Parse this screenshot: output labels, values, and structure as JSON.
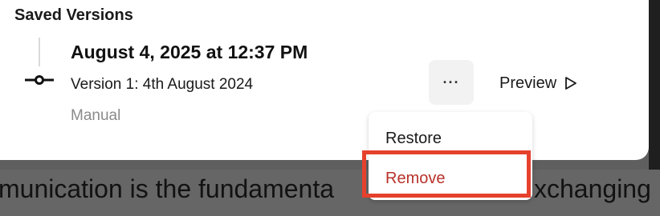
{
  "background_text": {
    "left": "munication is the fundamenta",
    "right": "xchanging"
  },
  "panel": {
    "title": "Saved Versions",
    "version": {
      "date": "August 4, 2025 at 12:37 PM",
      "name": "Version 1: 4th August 2024",
      "type": "Manual"
    },
    "more_label": "···",
    "preview_label": "Preview"
  },
  "menu": {
    "items": [
      {
        "label": "Restore"
      },
      {
        "label": "Remove"
      }
    ],
    "highlighted": "Remove"
  },
  "colors": {
    "remove_text": "#b8322a",
    "highlight_border": "#e5412d"
  },
  "icons": {
    "commit": "commit-icon",
    "preview": "play-outline-icon"
  }
}
